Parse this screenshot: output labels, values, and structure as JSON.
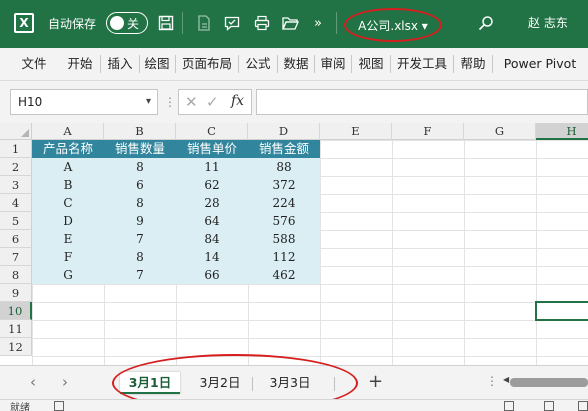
{
  "titlebar": {
    "excel_logo": "X",
    "autosave_label": "自动保存",
    "autosave_toggle": "关",
    "filename": "A公司.xlsx ▾",
    "overflow": "»",
    "user_name": "赵 志东",
    "icons": [
      "excel-logo",
      "save-icon",
      "new-file-icon",
      "comment-icon",
      "printer-icon",
      "folder-open-icon",
      "search-icon"
    ]
  },
  "ribbon": {
    "tabs": [
      "文件",
      "开始",
      "插入",
      "绘图",
      "页面布局",
      "公式",
      "数据",
      "审阅",
      "视图",
      "开发工具",
      "帮助",
      "Power Pivot"
    ]
  },
  "formula_bar": {
    "name_box": "H10",
    "cancel_icon": "✕",
    "enter_icon": "✓",
    "fx": "fx",
    "formula": ""
  },
  "grid": {
    "columns": [
      "A",
      "B",
      "C",
      "D",
      "E",
      "F",
      "G",
      "H"
    ],
    "rows": [
      "1",
      "2",
      "3",
      "4",
      "5",
      "6",
      "7",
      "8",
      "9",
      "10",
      "11",
      "12"
    ],
    "selected_cell": "H10",
    "table": {
      "headers": [
        "产品名称",
        "销售数量",
        "销售单价",
        "销售金额"
      ],
      "rows": [
        [
          "A",
          "8",
          "11",
          "88"
        ],
        [
          "B",
          "6",
          "62",
          "372"
        ],
        [
          "C",
          "8",
          "28",
          "224"
        ],
        [
          "D",
          "9",
          "64",
          "576"
        ],
        [
          "E",
          "7",
          "84",
          "588"
        ],
        [
          "F",
          "8",
          "14",
          "112"
        ],
        [
          "G",
          "7",
          "66",
          "462"
        ]
      ]
    },
    "header_color": "#31859c",
    "row_color": "#daeef3"
  },
  "sheets": {
    "tabs": [
      "3月1日",
      "3月2日",
      "3月3日"
    ],
    "active": "3月1日",
    "add_label": "+"
  },
  "statusbar": {
    "text": "就绪"
  },
  "colors": {
    "titlebar": "#217346",
    "annotation": "#d51f1f"
  }
}
